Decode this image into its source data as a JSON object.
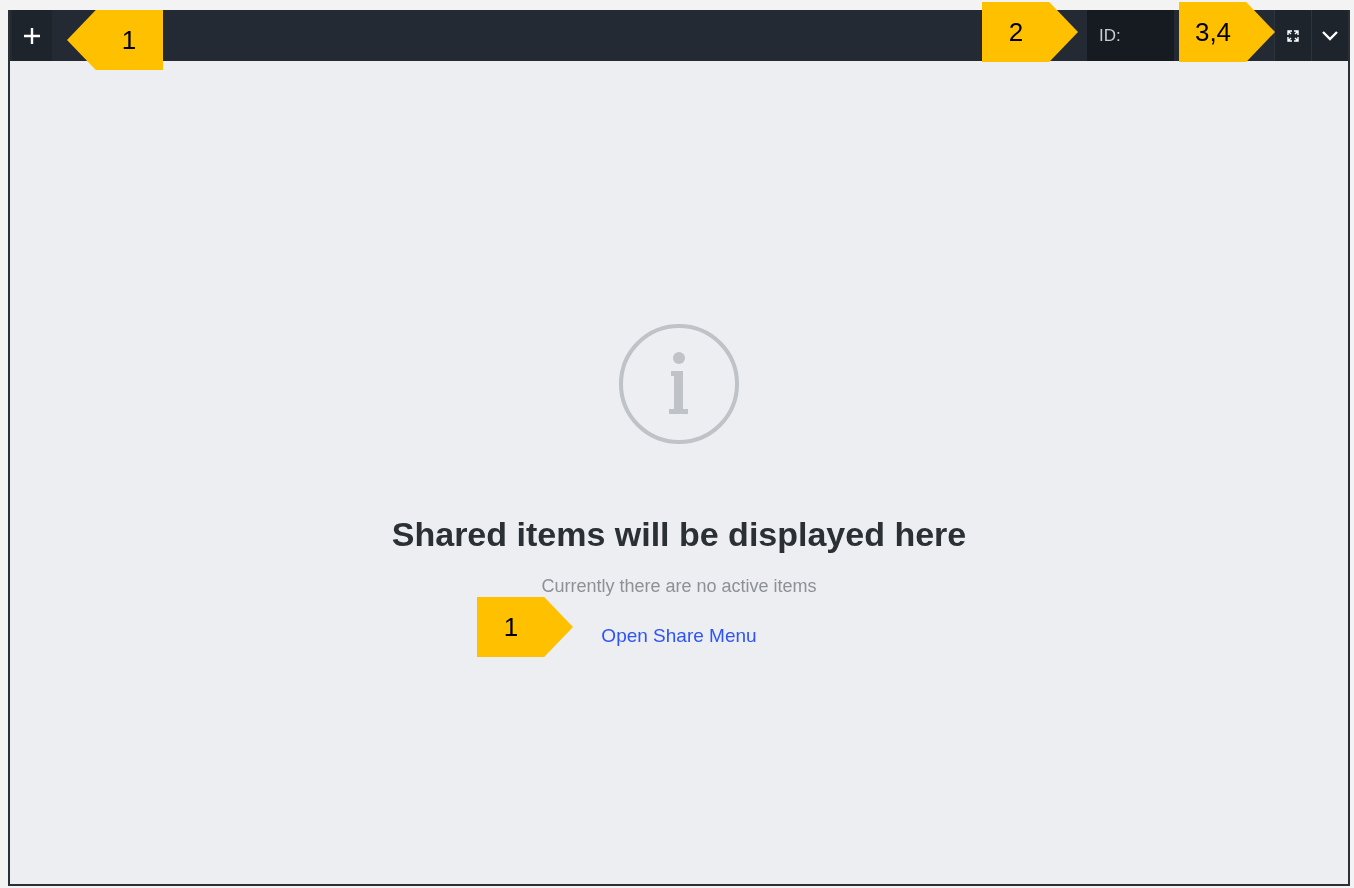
{
  "toolbar": {
    "id_field": {
      "label": "ID:"
    }
  },
  "empty_state": {
    "title": "Shared items will be displayed here",
    "message": "Currently there are no active items",
    "link": "Open Share Menu"
  },
  "callouts": [
    {
      "label": "1",
      "kind": "left"
    },
    {
      "label": "2",
      "kind": "right"
    },
    {
      "label": "3,4",
      "kind": "right"
    },
    {
      "label": "1",
      "kind": "right"
    }
  ]
}
